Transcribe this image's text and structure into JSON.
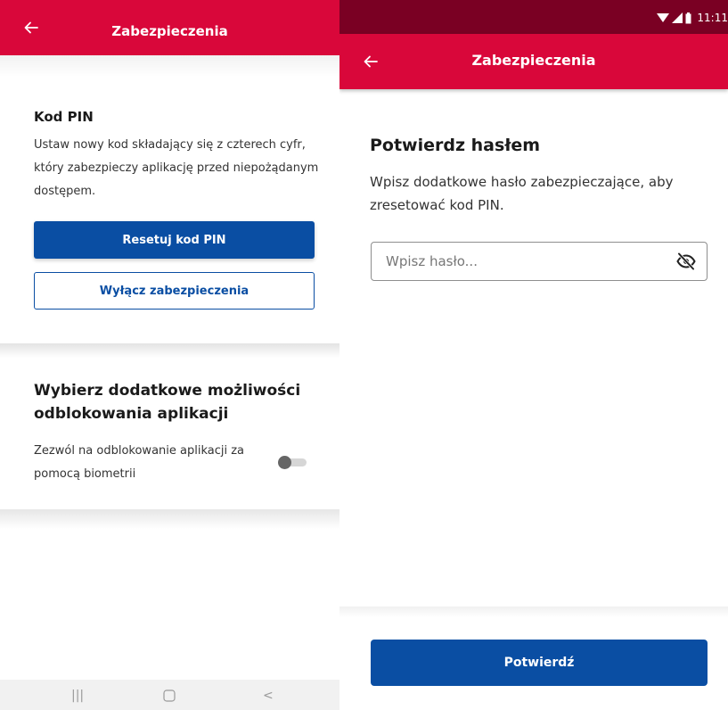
{
  "colors": {
    "brand_red": "#d9073a",
    "status_bar": "#7a0023",
    "primary_blue": "#0a4ea3"
  },
  "left_screen": {
    "appbar": {
      "title": "Zabezpieczenia",
      "back_icon": "arrow-left-icon"
    },
    "pin_card": {
      "heading": "Kod PIN",
      "description": "Ustaw nowy kod składający się z czterech cyfr, który zabezpieczy aplikację przed niepożądanym dostępem.",
      "reset_button_label": "Resetuj kod PIN",
      "disable_button_label": "Wyłącz zabezpieczenia"
    },
    "unlock_card": {
      "heading": "Wybierz dodatkowe możliwości odblokowania aplikacji",
      "biometrics_label": "Zezwól na odblokowanie aplikacji za pomocą biometrii",
      "biometrics_enabled": false
    },
    "navbar": {
      "recent_icon": "recent-apps-icon",
      "home_icon": "home-icon",
      "back_icon": "back-nav-icon",
      "recent_glyph": "|||",
      "back_glyph": "<"
    }
  },
  "right_screen": {
    "status_bar": {
      "time": "11:11",
      "icons": [
        "wifi-icon",
        "signal-icon",
        "battery-icon"
      ]
    },
    "appbar": {
      "title": "Zabezpieczenia",
      "back_icon": "arrow-left-icon"
    },
    "heading": "Potwierdz hasłem",
    "description": "Wpisz dodatkowe hasło zabezpieczające, aby zresetować kod PIN.",
    "password_field": {
      "placeholder": "Wpisz hasło...",
      "value": "",
      "visibility_icon": "eye-off-icon"
    },
    "confirm_button_label": "Potwierdź"
  }
}
